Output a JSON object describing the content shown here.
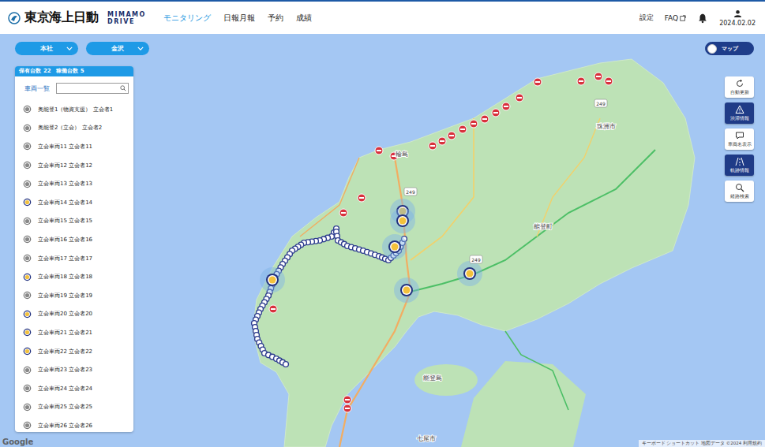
{
  "header": {
    "brand": "東京海上日動",
    "product_top": "MIMAMO",
    "product_bottom": "DRIVE",
    "nav": [
      {
        "label": "モニタリング",
        "selected": true
      },
      {
        "label": "日報月報",
        "selected": false
      },
      {
        "label": "予約",
        "selected": false
      },
      {
        "label": "成績",
        "selected": false
      }
    ],
    "settings": "設定",
    "faq": "FAQ",
    "date": "2024.02.02"
  },
  "filters": [
    {
      "label": "本社"
    },
    {
      "label": "金沢"
    }
  ],
  "view_toggle": {
    "label": "マップ",
    "map_mode": true
  },
  "summary": {
    "owned_label": "保有台数",
    "owned": "22",
    "active_label": "稼働台数",
    "active": "5"
  },
  "vehicle_list": {
    "title": "車両一覧",
    "items": [
      {
        "name": "奥能登1（物資支援） 立会者1",
        "active": false
      },
      {
        "name": "奥能登2（立会） 立会者2",
        "active": false
      },
      {
        "name": "立会車両11 立会者11",
        "active": false
      },
      {
        "name": "立会車両12 立会者12",
        "active": false
      },
      {
        "name": "立会車両13 立会者13",
        "active": false
      },
      {
        "name": "立会車両14 立会者14",
        "active": true
      },
      {
        "name": "立会車両15 立会者15",
        "active": false
      },
      {
        "name": "立会車両16 立会者16",
        "active": false
      },
      {
        "name": "立会車両17 立会者17",
        "active": false
      },
      {
        "name": "立会車両18 立会者18",
        "active": true
      },
      {
        "name": "立会車両19 立会者19",
        "active": false
      },
      {
        "name": "立会車両20 立会者20",
        "active": true
      },
      {
        "name": "立会車両21 立会者21",
        "active": true
      },
      {
        "name": "立会車両22 立会者22",
        "active": true
      },
      {
        "name": "立会車両23 立会者23",
        "active": false
      },
      {
        "name": "立会車両24 立会者24",
        "active": false
      },
      {
        "name": "立会車両25 立会者25",
        "active": false
      },
      {
        "name": "立会車両26 立会者26",
        "active": false
      }
    ]
  },
  "tools": [
    {
      "label": "自動更新",
      "on": false
    },
    {
      "label": "渋滞情報",
      "on": true
    },
    {
      "label": "車両名表示",
      "on": false
    },
    {
      "label": "軌跡情報",
      "on": true
    },
    {
      "label": "経路検索",
      "on": false
    }
  ],
  "map": {
    "labels": [
      {
        "text": "珠洲市"
      },
      {
        "text": "能登町"
      },
      {
        "text": "輪島"
      },
      {
        "text": "能登島"
      },
      {
        "text": "七尾市"
      }
    ],
    "shields": [
      {
        "text": "249"
      },
      {
        "text": "249"
      },
      {
        "text": "249"
      }
    ],
    "google": "Google",
    "attribution": "キーボード ショートカット 地図データ ©2024 利用規約"
  }
}
